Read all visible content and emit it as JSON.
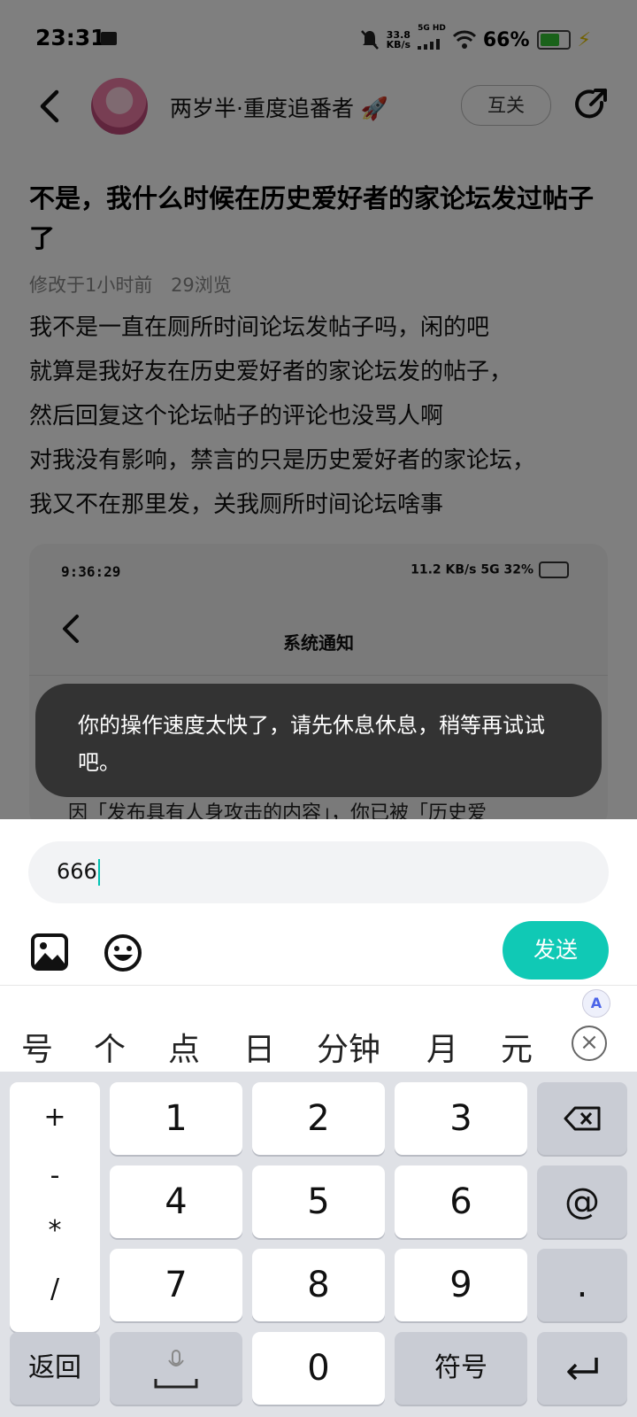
{
  "status_bar": {
    "time": "23:31",
    "net_speed_value": "33.8",
    "net_speed_unit": "KB/s",
    "signal_label": "5G HD",
    "battery": "66%"
  },
  "header": {
    "author_name": "两岁半·重度追番者",
    "mutual_label": "互关"
  },
  "post": {
    "title": "不是，我什么时候在历史爱好者的家论坛发过帖子了",
    "modified": "修改于1小时前",
    "views": "29浏览",
    "lines": [
      "我不是一直在厕所时间论坛发帖子吗，闲的吧",
      "就算是我好友在历史爱好者的家论坛发的帖子，",
      "然后回复这个论坛帖子的评论也没骂人啊",
      "对我没有影响，禁言的只是历史爱好者的家论坛，",
      "我又不在那里发，关我厕所时间论坛啥事"
    ],
    "embed": {
      "time": "9:36:29",
      "status": "11.2 KB/s 5G 32%",
      "title": "系统通知",
      "partial_text": "因「发布具有人身攻击的内容」，你已被「历史爱"
    }
  },
  "toast": {
    "message": "你的操作速度太快了，请先休息休息，稍等再试试吧。"
  },
  "composer": {
    "input_value": "666",
    "send_label": "发送"
  },
  "keyboard": {
    "candidates": [
      "号",
      "个",
      "点",
      "日",
      "分钟",
      "月",
      "元"
    ],
    "symbols": [
      "+",
      "-",
      "*",
      "/"
    ],
    "digits": [
      "1",
      "2",
      "3",
      "4",
      "5",
      "6",
      "7",
      "8",
      "9",
      "0"
    ],
    "at": "@",
    "dot": ".",
    "back_label": "返回",
    "symbol_label": "符号"
  }
}
